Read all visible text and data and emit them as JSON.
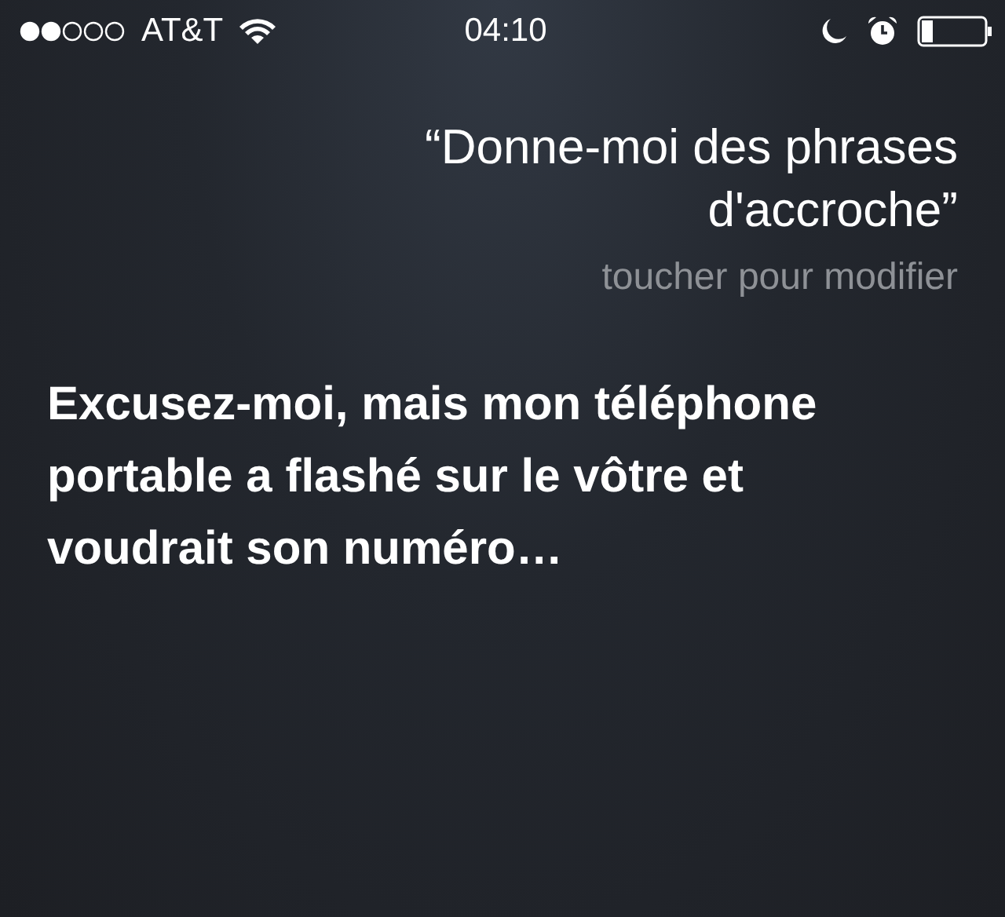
{
  "status_bar": {
    "carrier": "AT&T",
    "time": "04:10"
  },
  "query": {
    "text": "“Donne-moi des phrases d'accroche”",
    "hint": "toucher pour modifier"
  },
  "answer": {
    "text": "Excusez-moi, mais mon téléphone portable a flashé sur le vôtre et voudrait son numéro…"
  }
}
